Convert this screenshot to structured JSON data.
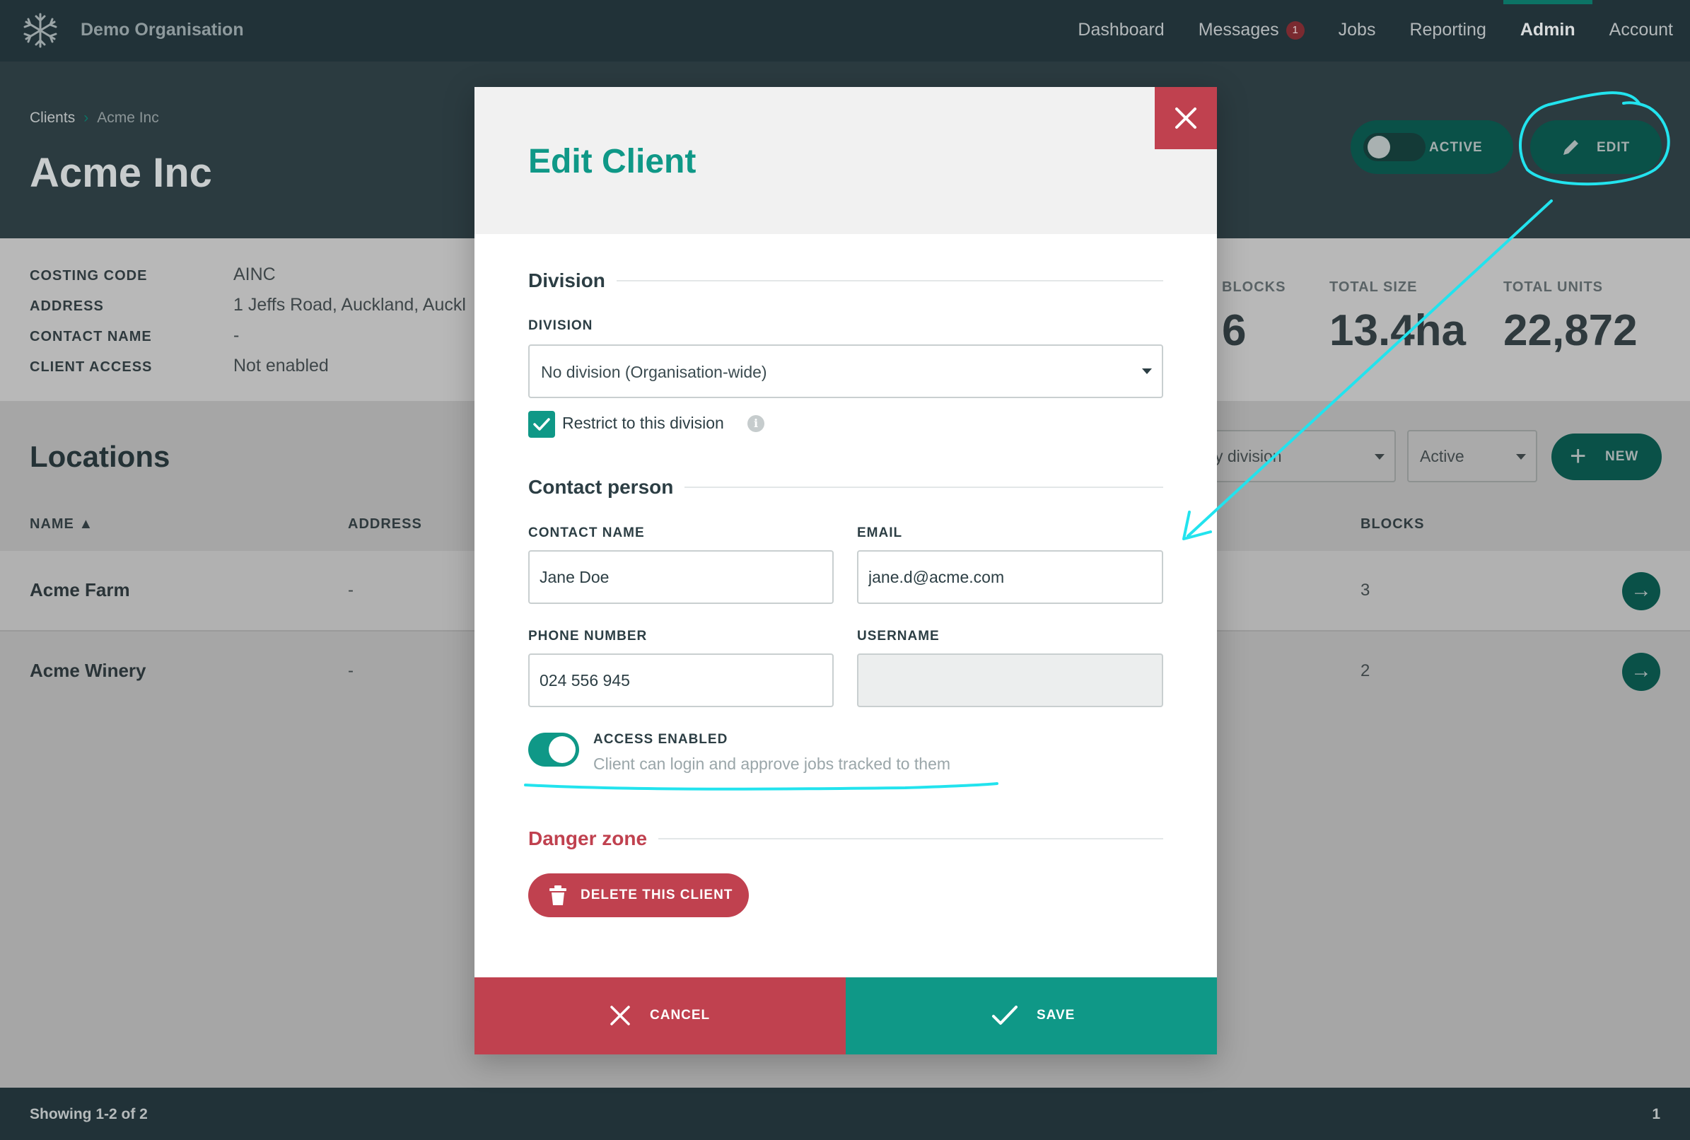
{
  "nav": {
    "org_name": "Demo Organisation",
    "links": [
      "Dashboard",
      "Messages",
      "Jobs",
      "Reporting",
      "Admin",
      "Account"
    ],
    "messages_badge": "1",
    "active_link": "Admin"
  },
  "header": {
    "breadcrumb_root": "Clients",
    "breadcrumb_current": "Acme Inc",
    "title": "Acme Inc",
    "status_label": "ACTIVE",
    "edit_label": "EDIT"
  },
  "client_info": {
    "costing_code_label": "COSTING CODE",
    "costing_code": "AINC",
    "address_label": "ADDRESS",
    "address": "1 Jeffs Road, Auckland, Auckl",
    "contact_name_label": "CONTACT NAME",
    "contact_name": "-",
    "client_access_label": "CLIENT ACCESS",
    "client_access": "Not enabled"
  },
  "stats": {
    "blocks_label": "BLOCKS",
    "blocks": "6",
    "total_size_label": "TOTAL SIZE",
    "total_size": "13.4ha",
    "total_units_label": "TOTAL UNITS",
    "total_units": "22,872"
  },
  "locations": {
    "title": "Locations",
    "division_filter": "y division",
    "status_filter": "Active",
    "new_label": "NEW",
    "columns": {
      "name": "NAME ▲",
      "address": "ADDRESS",
      "blocks": "BLOCKS"
    },
    "rows": [
      {
        "name": "Acme Farm",
        "address": "-",
        "blocks": "3"
      },
      {
        "name": "Acme Winery",
        "address": "-",
        "blocks": "2"
      }
    ]
  },
  "footer": {
    "showing": "Showing 1-2 of 2",
    "page": "1"
  },
  "modal": {
    "title": "Edit Client",
    "division_section": "Division",
    "division_label": "DIVISION",
    "division_value": "No division (Organisation-wide)",
    "restrict_label": "Restrict to this division",
    "restrict_checked": true,
    "info_glyph": "i",
    "contact_section": "Contact person",
    "contact_name_label": "CONTACT NAME",
    "contact_name_value": "Jane Doe",
    "email_label": "EMAIL",
    "email_value": "jane.d@acme.com",
    "phone_label": "PHONE NUMBER",
    "phone_value": "024 556 945",
    "username_label": "USERNAME",
    "username_value": "",
    "access_title": "ACCESS ENABLED",
    "access_desc": "Client can login and approve jobs tracked to them",
    "access_enabled": true,
    "danger_section": "Danger zone",
    "delete_label": "DELETE THIS CLIENT",
    "cancel_label": "CANCEL",
    "save_label": "SAVE"
  },
  "colors": {
    "accent": "#0f9887",
    "danger": "#c0414f",
    "nav_bg": "#213238",
    "annotation": "#22e3ee"
  }
}
